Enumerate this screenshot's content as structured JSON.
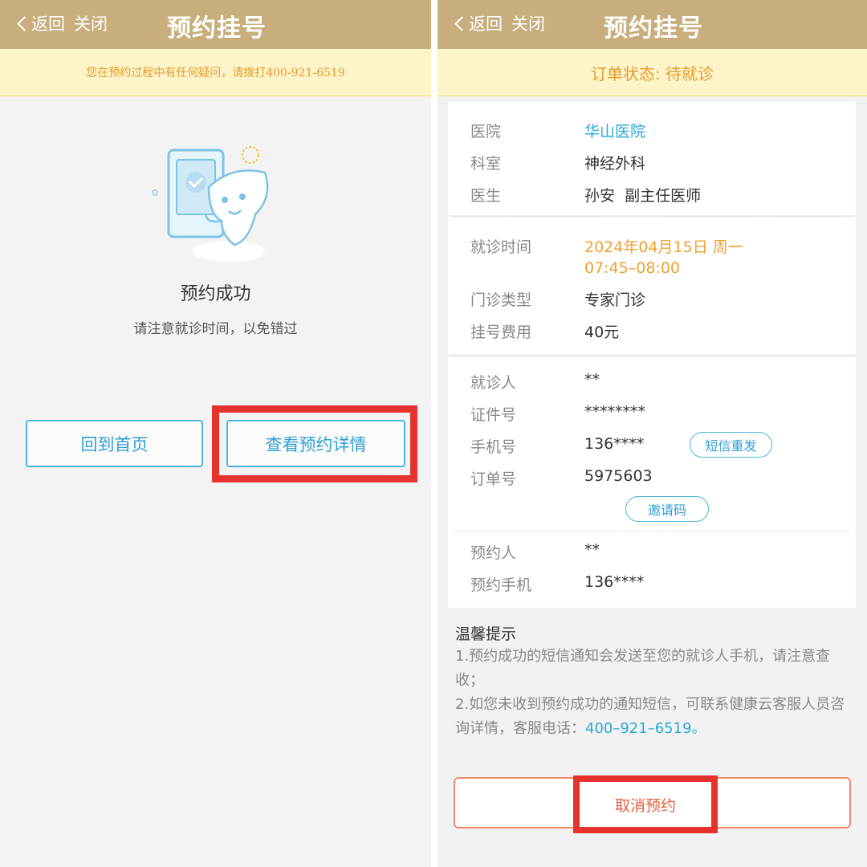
{
  "left": {
    "nav": {
      "back": "返回",
      "close": "关闭",
      "title": "预约挂号"
    },
    "notice": "您在预约过程中有任何疑问，请拨打400-921-6519",
    "success_title": "预约成功",
    "success_sub": "请注意就诊时间，以免错过",
    "btn_home": "回到首页",
    "btn_detail": "查看预约详情"
  },
  "right": {
    "nav": {
      "back": "返回",
      "close": "关闭",
      "title": "预约挂号"
    },
    "order_status": "订单状态: 待就诊",
    "hospital": {
      "label": "医院",
      "value": "华山医院"
    },
    "department": {
      "label": "科室",
      "value": "神经外科"
    },
    "doctor": {
      "label": "医生",
      "value": "孙安  副主任医师"
    },
    "visit_time": {
      "label": "就诊时间",
      "date": "2024年04月15日 周一",
      "time": "07:45–08:00"
    },
    "clinic_type": {
      "label": "门诊类型",
      "value": "专家门诊"
    },
    "fee": {
      "label": "挂号费用",
      "value": "40元"
    },
    "patient": {
      "label": "就诊人",
      "value": "**"
    },
    "id_number": {
      "label": "证件号",
      "value": "********"
    },
    "phone": {
      "label": "手机号",
      "value": "136****"
    },
    "sms_resend": "短信重发",
    "order_no": {
      "label": "订单号",
      "value": "5975603"
    },
    "invite_code": "邀请码",
    "booker": {
      "label": "预约人",
      "value": "**"
    },
    "booker_phone": {
      "label": "预约手机",
      "value": "136****"
    },
    "tips_title": "温馨提示",
    "tip1": "1.预约成功的短信通知会发送至您的就诊人手机，请注意查收；",
    "tip2": "2.如您未收到预约成功的通知短信，可联系健康云客服人员咨询详情，客服电话：",
    "tip2_phone": "400–921–6519",
    "tip2_end": "。",
    "cancel": "取消预约"
  },
  "colors": {
    "header": "#c8ae7c",
    "accent": "#2e9fd4",
    "warning": "#f0a030",
    "highlight": "#e5322d"
  }
}
